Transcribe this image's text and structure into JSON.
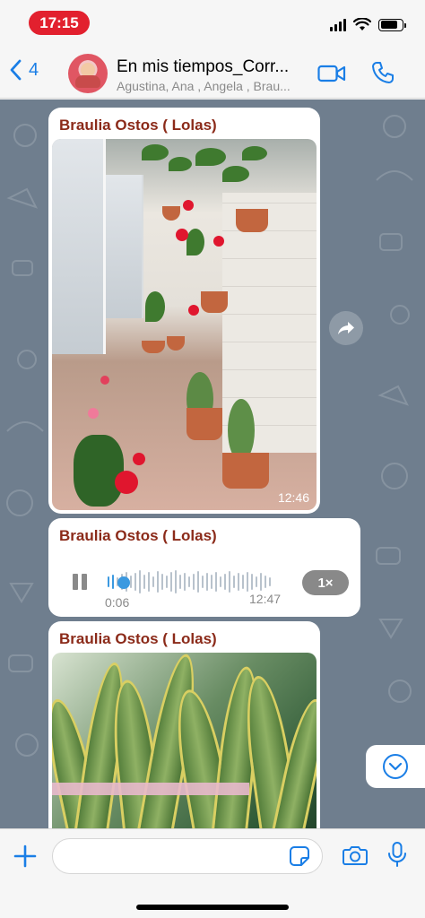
{
  "status_bar": {
    "time": "17:15"
  },
  "header": {
    "back_count": "4",
    "title": "En mis tiempos_Corr...",
    "subtitle": "Agustina, Ana , Angela , Brau..."
  },
  "messages": [
    {
      "sender": "Braulia Ostos ( Lolas)",
      "type": "image",
      "time": "12:46"
    },
    {
      "sender": "Braulia Ostos ( Lolas)",
      "type": "voice",
      "duration": "0:06",
      "time": "12:47",
      "speed": "1×",
      "progress": 0.05
    },
    {
      "sender": "Braulia Ostos ( Lolas)",
      "type": "image"
    }
  ],
  "colors": {
    "accent": "#1a7ee6",
    "sender_name": "#8b2a19",
    "status_pill": "#e2202e",
    "chat_background": "#6f7e8e"
  },
  "icons": [
    "chevron-left-icon",
    "video-call-icon",
    "phone-icon",
    "share-forward-icon",
    "pause-icon",
    "chevron-down-icon",
    "plus-icon",
    "sticker-icon",
    "camera-icon",
    "microphone-icon"
  ]
}
